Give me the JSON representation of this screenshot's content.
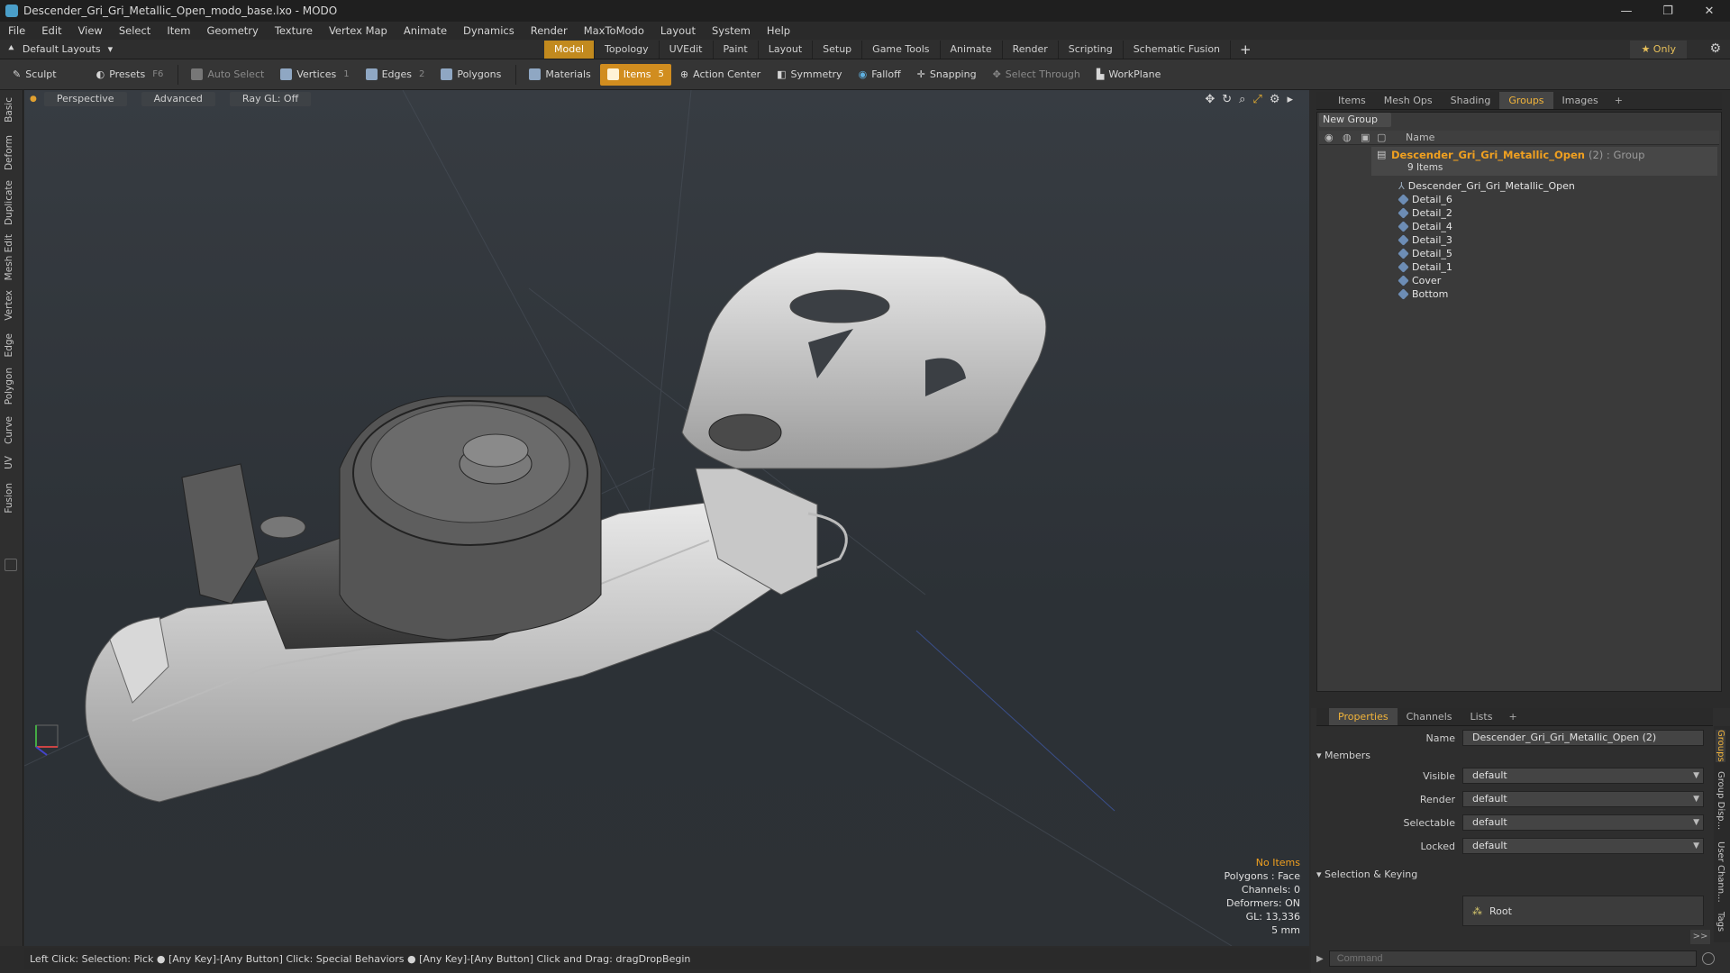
{
  "window": {
    "title": "Descender_Gri_Gri_Metallic_Open_modo_base.lxo - MODO",
    "controls": [
      "—",
      "❐",
      "✕"
    ]
  },
  "menubar": [
    "File",
    "Edit",
    "View",
    "Select",
    "Item",
    "Geometry",
    "Texture",
    "Vertex Map",
    "Animate",
    "Dynamics",
    "Render",
    "MaxToModo",
    "Layout",
    "System",
    "Help"
  ],
  "layoutbar": {
    "layout_label": "Default Layouts",
    "tabs": [
      "Model",
      "Topology",
      "UVEdit",
      "Paint",
      "Layout",
      "Setup",
      "Game Tools",
      "Animate",
      "Render",
      "Scripting",
      "Schematic Fusion"
    ],
    "active_tab": "Model",
    "only_label": "Only"
  },
  "toolbar": {
    "sculpt": "Sculpt",
    "presets": "Presets",
    "presets_key": "F6",
    "auto_select": "Auto Select",
    "vertices": "Vertices",
    "vertices_key": "1",
    "edges": "Edges",
    "edges_key": "2",
    "polygons": "Polygons",
    "materials": "Materials",
    "items": "Items",
    "items_key": "5",
    "action_center": "Action Center",
    "symmetry": "Symmetry",
    "falloff": "Falloff",
    "snapping": "Snapping",
    "select_through": "Select Through",
    "workplane": "WorkPlane"
  },
  "left_tabs": [
    "Basic",
    "Deform",
    "Duplicate",
    "Mesh Edit",
    "Vertex",
    "Edge",
    "Polygon",
    "Curve",
    "UV",
    "Fusion"
  ],
  "viewport": {
    "perspective": "Perspective",
    "advanced": "Advanced",
    "raygl": "Ray GL: Off",
    "hud": {
      "no_items": "No Items",
      "polygons": "Polygons : Face",
      "channels": "Channels: 0",
      "deformers": "Deformers: ON",
      "gl": "GL: 13,336",
      "scale": "5 mm"
    }
  },
  "statusbar": "Left Click: Selection: Pick ● [Any Key]-[Any Button] Click: Special Behaviors ● [Any Key]-[Any Button] Click and Drag: dragDropBegin",
  "panel_tabs": [
    "Items",
    "Mesh Ops",
    "Shading",
    "Groups",
    "Images"
  ],
  "active_panel_tab": "Groups",
  "groups": {
    "new_group": "New Group",
    "col_name": "Name",
    "parent_name": "Descender_Gri_Gri_Metallic_Open",
    "parent_suffix": "(2) : Group",
    "parent_count": "9 Items",
    "children": [
      "Descender_Gri_Gri_Metallic_Open",
      "Detail_6",
      "Detail_2",
      "Detail_4",
      "Detail_3",
      "Detail_5",
      "Detail_1",
      "Cover",
      "Bottom"
    ]
  },
  "props": {
    "tabs": [
      "Properties",
      "Channels",
      "Lists"
    ],
    "active_tab": "Properties",
    "name_label": "Name",
    "name_value": "Descender_Gri_Gri_Metallic_Open (2)",
    "members": "Members",
    "visible_label": "Visible",
    "visible_value": "default",
    "render_label": "Render",
    "render_value": "default",
    "selectable_label": "Selectable",
    "selectable_value": "default",
    "locked_label": "Locked",
    "locked_value": "default",
    "selection_keying": "Selection & Keying",
    "root": "Root",
    "more": ">>",
    "side_tabs": [
      "Groups",
      "Group Disp...",
      "User Chann...",
      "Tags"
    ]
  },
  "command": {
    "placeholder": "Command"
  },
  "colors": {
    "accent": "#d18d1f",
    "group_highlight": "#f0a020",
    "panel_bg": "#3a3a3a"
  }
}
